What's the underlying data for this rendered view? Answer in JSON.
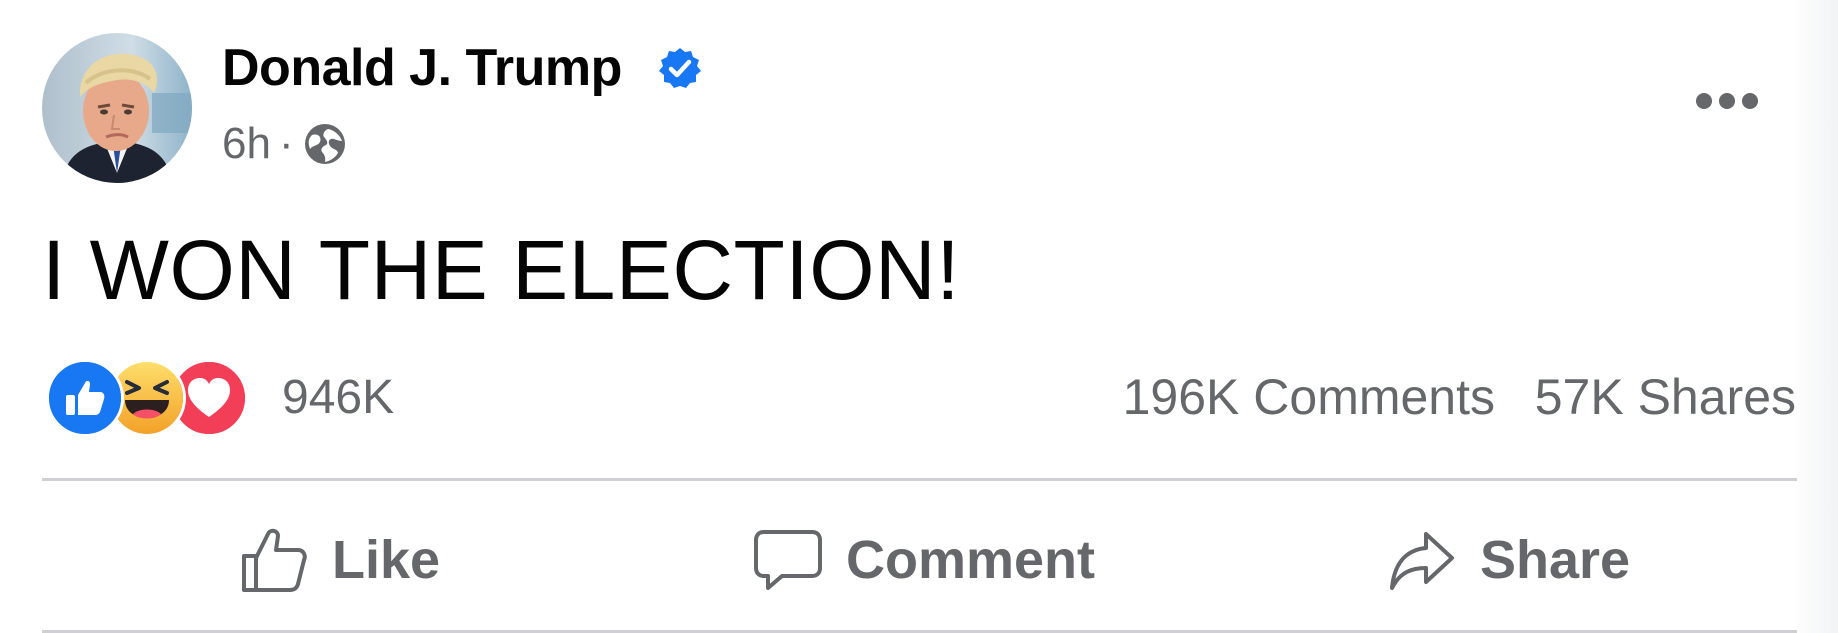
{
  "post": {
    "author_name": "Donald J. Trump",
    "timestamp": "6h",
    "separator": "·",
    "text": "I WON THE ELECTION!",
    "reaction_count": "946K",
    "comments_count": "196K Comments",
    "shares_count": "57K Shares"
  },
  "icons": {
    "verified": "verified-badge-icon",
    "audience": "globe-icon",
    "more": "more-options-icon",
    "reactions": [
      "like-reaction-icon",
      "haha-reaction-icon",
      "love-reaction-icon"
    ]
  },
  "actions": {
    "like_label": "Like",
    "comment_label": "Comment",
    "share_label": "Share"
  },
  "colors": {
    "accent": "#1877f2",
    "secondary_text": "#65676b",
    "primary_text": "#050505",
    "love": "#f33e58",
    "haha": "#f7b125",
    "divider": "#ced0d4"
  }
}
